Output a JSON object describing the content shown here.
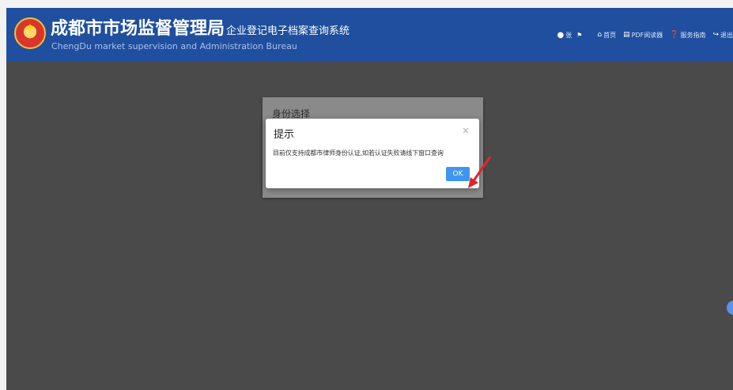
{
  "header": {
    "title": "成都市市场监督管理局",
    "subtitle": "企业登记电子档案查询系统",
    "title_en": "ChengDu market supervision and Administration Bureau",
    "user_name": "张",
    "nav": [
      {
        "label": "首页",
        "icon": "home-icon"
      },
      {
        "label": "PDF阅读器",
        "icon": "pdf-reader-icon"
      },
      {
        "label": "服务指南",
        "icon": "question-circle-icon"
      },
      {
        "label": "退出",
        "icon": "logout-icon"
      }
    ]
  },
  "background_dialog": {
    "title": "身份选择"
  },
  "tip_dialog": {
    "title": "提示",
    "close": "×",
    "message": "目前仅支持成都市律师身份认证,如若认证失败请线下窗口查询",
    "ok_label": "OK"
  },
  "colors": {
    "header_bg": "#1f4f9e",
    "overlay": "#4a4a4a",
    "ok_button": "#3f96f0",
    "annotation_arrow": "#e0242c"
  }
}
